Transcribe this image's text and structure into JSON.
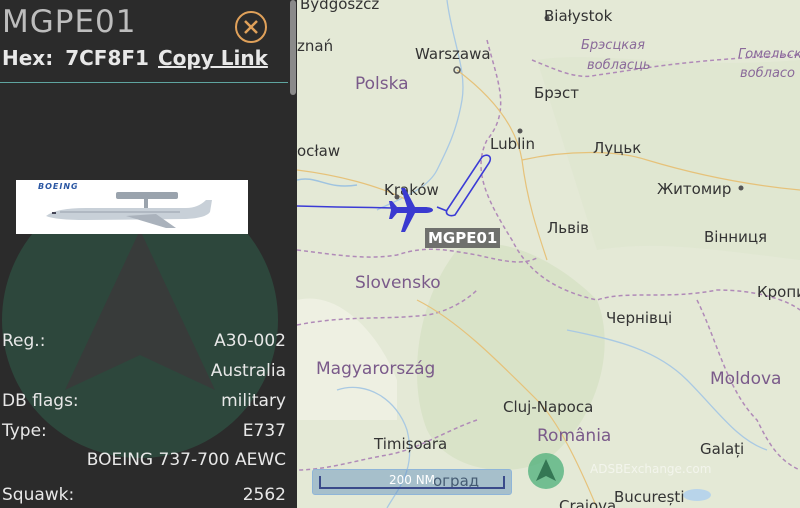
{
  "panel": {
    "callsign": "MGPE01",
    "hex_label": "Hex:",
    "hex_value": "7CF8F1",
    "copy_link_label": "Copy Link",
    "photo_logo_text": "BOEING",
    "rows": [
      {
        "label": "Reg.:",
        "value": "A30-002"
      },
      {
        "label": "",
        "value": "Australia"
      },
      {
        "label": "DB flags:",
        "value": "military"
      },
      {
        "label": "Type:",
        "value": "E737"
      },
      {
        "label": "",
        "value": "BOEING 737-700 AEWC"
      },
      {
        "label": "Squawk:",
        "value": "2562"
      }
    ]
  },
  "map": {
    "aircraft_label": "MGPE01",
    "scale_label": "200 NM",
    "watermark": "ADSBExchange.com",
    "labels": {
      "bydgoszcz": "Bydgoszcz",
      "bialystok": "Białystok",
      "poznan": "znań",
      "warszawa": "Warszawa",
      "polska": "Polska",
      "brest": "Брэст",
      "bresckaya": "Брэсцкая",
      "voblasc1": "вобласць",
      "homelskaya": "Гомельска",
      "voblasc2": "вобласо",
      "wroclaw": "ocław",
      "lublin": "Lublin",
      "lutsk": "Луцьк",
      "krakow": "Kraków",
      "zhytomyr": "Житомир",
      "lviv": "Львів",
      "vinnytsia": "Вінниця",
      "slovensko": "Slovensko",
      "kropyvnytskyi": "Кропив",
      "chernivtsi": "Чернівці",
      "magyarorszag": "Magyarország",
      "moldova": "Moldova",
      "cluj": "Cluj-Napoca",
      "romania": "România",
      "timisoara": "Timișoara",
      "galati": "Galați",
      "belgrad": "оград",
      "bucuresti": "București",
      "craiova": "Craiova"
    }
  },
  "colors": {
    "panel_bg": "#2b2b2b",
    "accent_teal": "#5fa5a0",
    "close_orange": "#e0a15a",
    "track_blue": "#3b3bd6",
    "aircraft_blue": "#3a3ad0"
  }
}
